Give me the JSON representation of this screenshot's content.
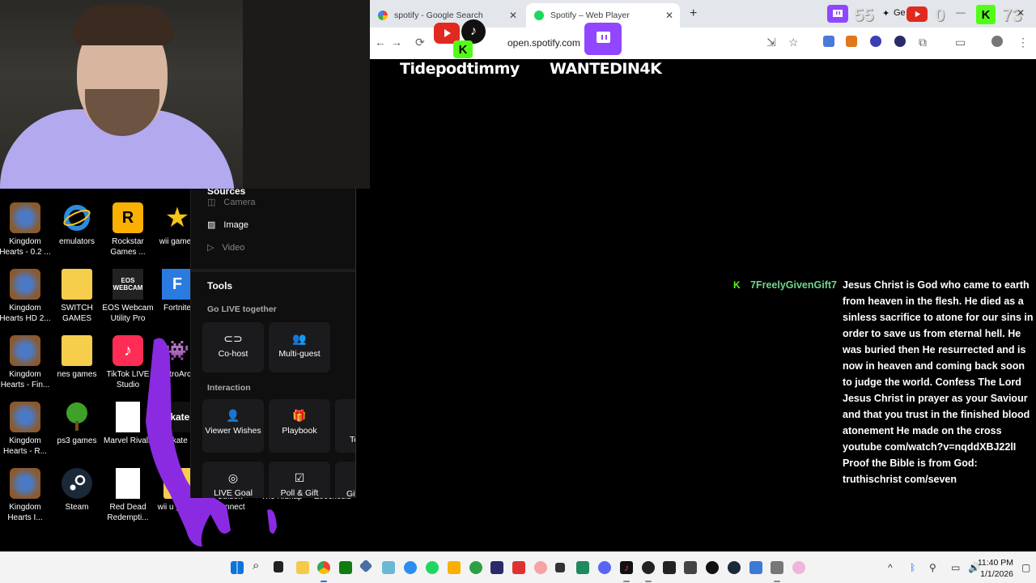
{
  "browser": {
    "tabs": [
      {
        "title": "spotify - Google Search",
        "active": false
      },
      {
        "title": "Spotify – Web Player",
        "active": true
      }
    ],
    "url": "open.spotify.com"
  },
  "stream": {
    "alert_names": [
      "Tidepodtimmy",
      "WANTEDIN4K"
    ],
    "counters": [
      "55",
      "Ge",
      "0",
      "73"
    ]
  },
  "desktop": {
    "icons": [
      "Kingdom Hearts - 0.2 ...",
      "emulators",
      "Rockstar Games ...",
      "wii games",
      "Kingdom Hearts HD 2...",
      "SWITCH GAMES",
      "EOS Webcam Utility Pro",
      "Fortnite",
      "Kingdom Hearts - Fin...",
      "nes games",
      "TikTok LIVE Studio",
      "RetroArch",
      "Kingdom Hearts - R...",
      "ps3 games",
      "Marvel Rivals",
      "Skate",
      "Kingdom Hearts I...",
      "Steam",
      "Red Dead Redempti...",
      "wii u games",
      "Ubisoft Connect",
      "The Kidnap",
      "Zoochosis"
    ],
    "eos_label": "EOS\nWEBCAM",
    "skate_label": "skate"
  },
  "panel": {
    "sources_heading": "Sources",
    "sources": [
      "Camera",
      "Image",
      "Video"
    ],
    "tools_heading": "Tools",
    "go_live_heading": "Go LIVE together",
    "go_live_tiles": [
      "Co-host",
      "Multi-guest"
    ],
    "interaction_heading": "Interaction",
    "interaction_tiles": [
      "Viewer Wishes",
      "Playbook",
      "LIVE Goal",
      "Poll & Gift"
    ],
    "cutoff_labels": [
      "To",
      "Gif"
    ]
  },
  "chat": {
    "username": "7FreelyGivenGift7",
    "message": "Jesus Christ is God who came to earth from heaven in the flesh. He died as a sinless sacrifice to atone for our sins in order to save us from eternal hell. He was buried then He resurrected and is now in heaven and coming back soon to judge the world. Confess The Lord Jesus Christ in prayer as your Saviour and that you trust in the finished blood atonement He made on the cross youtube com/watch?v=nqddXBJ22lI Proof the Bible is from God: truthischrist com/seven"
  },
  "taskbar": {
    "time": "11:40 PM",
    "date": "1/1/2026"
  },
  "colors": {
    "kick_green": "#53fc18",
    "twitch_purple": "#9146ff",
    "chat_name": "#6fd68f"
  }
}
